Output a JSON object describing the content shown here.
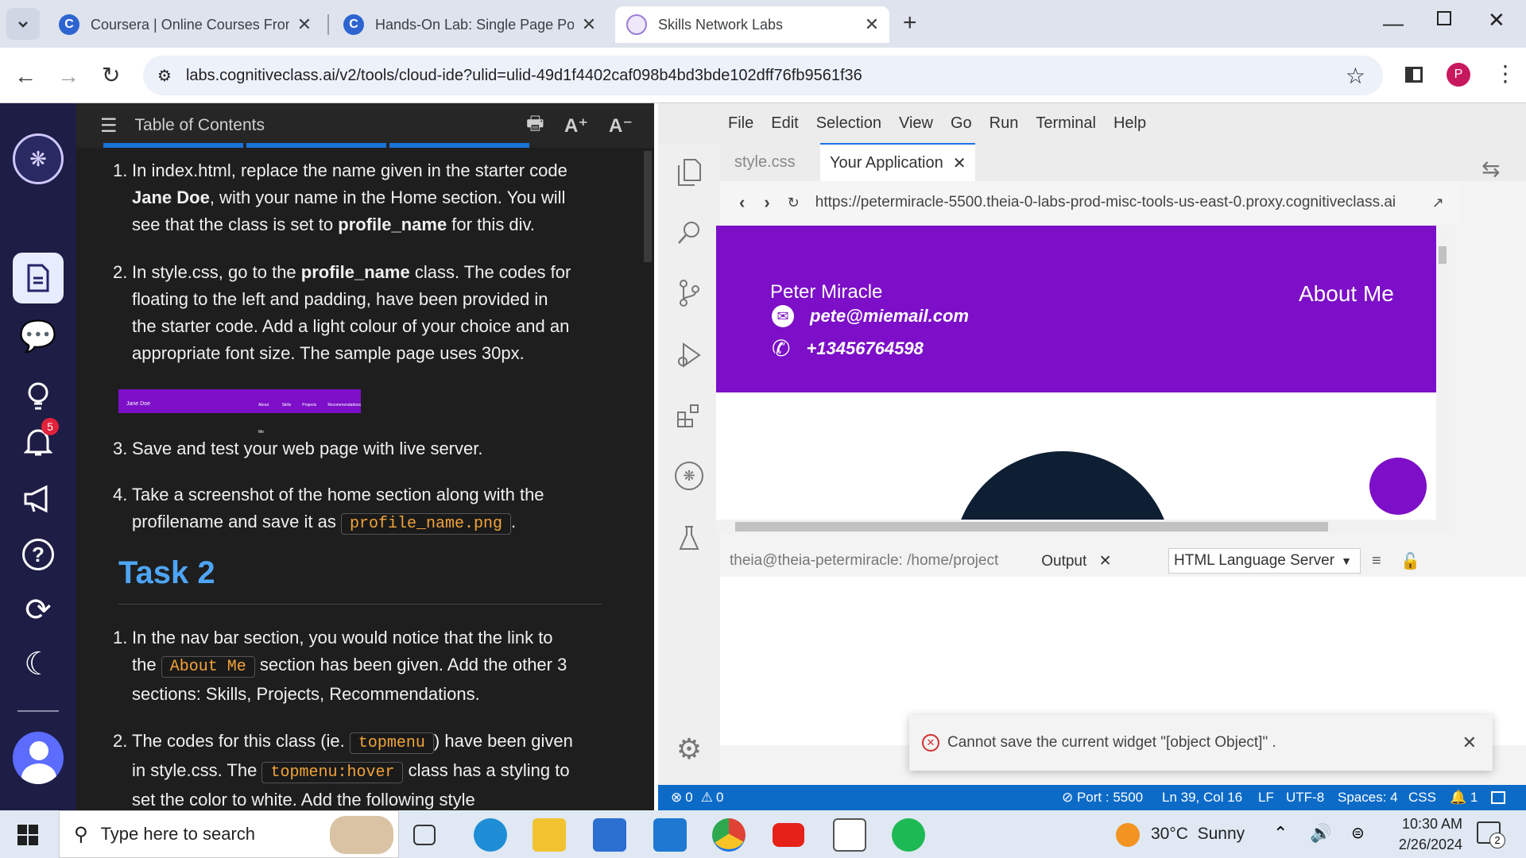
{
  "browser": {
    "tabs": [
      {
        "title": "Coursera | Online Courses From",
        "favicon_color": "#2d64d0"
      },
      {
        "title": "Hands-On Lab: Single Page Por",
        "favicon_color": "#2d64d0"
      },
      {
        "title": "Skills Network Labs",
        "favicon_color": "#9a7cd6"
      }
    ],
    "new_tab": "+",
    "url": "labs.cognitiveclass.ai/v2/tools/cloud-ide?ulid=ulid-49d1f4402caf098b4bd3bde102dff76fb9561f36",
    "profile_initial": "P"
  },
  "rail": {
    "notification_count": "5"
  },
  "toc": {
    "header": "Table of Contents",
    "font_increase": "A⁺",
    "font_decrease": "A⁻",
    "steps_a": [
      {
        "num": "1.",
        "t1": "In index.html, replace the name given in the starter code ",
        "b1": "Jane Doe",
        "t2": ", with your name in the Home section. You will see that the class is set to ",
        "b2": "profile_name",
        "t3": " for this div."
      },
      {
        "num": "2.",
        "t1": "In style.css, go to the ",
        "b1": "profile_name",
        "t2": " class. The codes for floating to the left and padding, have been provided in the starter code. Add a light colour of your choice and an appropriate font size. The sample page uses 30px."
      }
    ],
    "thumbnail": {
      "name": "Jane Doe",
      "nav": [
        "About Me",
        "Skills",
        "Projects",
        "Recommendations"
      ]
    },
    "step3": {
      "num": "3.",
      "text": "Save and test your web page with live server."
    },
    "step4": {
      "num": "4.",
      "text": "Take a screenshot of the home section along with the profilename and save it as ",
      "code": "profile_name.png",
      "end": "."
    },
    "task2_heading": "Task 2",
    "task2_step1": {
      "num": "1.",
      "t1": "In the nav bar section, you would notice that the link to the ",
      "code": "About Me",
      "t2": " section has been given. Add the other 3 sections: Skills, Projects, Recommendations."
    },
    "task2_step2": {
      "num": "2.",
      "t1": "The codes for this class (ie. ",
      "code1": "topmenu",
      "t2": ") have been given in style.css. The ",
      "code2": "topmenu:hover",
      "t3": " class has a styling to set the color to white. Add the following style"
    }
  },
  "ide": {
    "menu": [
      "File",
      "Edit",
      "Selection",
      "View",
      "Go",
      "Run",
      "Terminal",
      "Help"
    ],
    "tabs": [
      {
        "label": "style.css",
        "active": false
      },
      {
        "label": "Your Application",
        "active": true
      }
    ],
    "preview_url": "https://petermiracle-5500.theia-0-labs-prod-misc-tools-us-east-0.proxy.cognitiveclass.ai",
    "app": {
      "name": "Peter Miracle",
      "email": "pete@miemail.com",
      "phone": "+13456764598",
      "nav": "About Me",
      "accent": "#7c0fc7"
    },
    "panel": {
      "terminal_tab": "theia@theia-petermiracle: /home/project",
      "output_tab": "Output",
      "channel": "HTML Language Server"
    },
    "toast": {
      "message": "Cannot save the current widget \"[object Object]\" ."
    },
    "status": {
      "errors": "0",
      "warnings": "0",
      "port": "Port : 5500",
      "position": "Ln 39, Col 16",
      "eol": "LF",
      "encoding": "UTF-8",
      "spaces": "Spaces: 4",
      "language": "CSS",
      "notifications": "1"
    }
  },
  "taskbar": {
    "search_placeholder": "Type here to search",
    "weather": "30°C  Sunny",
    "time": "10:30 AM",
    "date": "2/26/2024",
    "notif_count": "2"
  }
}
